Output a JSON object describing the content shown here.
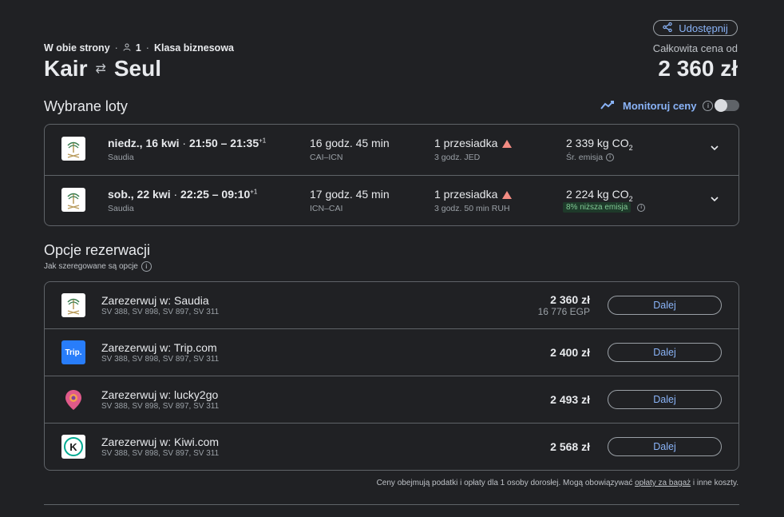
{
  "share_label": "Udostępnij",
  "trip": {
    "type": "W obie strony",
    "passengers": "1",
    "cabin": "Klasa biznesowa",
    "origin": "Kair",
    "destination": "Seul"
  },
  "price": {
    "label": "Całkowita cena od",
    "total": "2 360 zł"
  },
  "selected": {
    "title": "Wybrane loty",
    "monitor_label": "Monitoruj ceny",
    "flights": [
      {
        "date": "niedz., 16 kwi",
        "times": "21:50 – 21:35",
        "plus": "+1",
        "airline": "Saudia",
        "duration": "16 godz. 45 min",
        "airports": "CAI–ICN",
        "stops": "1 przesiadka",
        "layover": "3 godz. JED",
        "co2": "2 339 kg CO",
        "co2_sub": "2",
        "emission": "Śr. emisja"
      },
      {
        "date": "sob., 22 kwi",
        "times": "22:25 – 09:10",
        "plus": "+1",
        "airline": "Saudia",
        "duration": "17 godz. 45 min",
        "airports": "ICN–CAI",
        "stops": "1 przesiadka",
        "layover": "3 godz. 50 min RUH",
        "co2": "2 224 kg CO",
        "co2_sub": "2",
        "emission": "8% niższa emisja"
      }
    ]
  },
  "booking": {
    "title": "Opcje rezerwacji",
    "subtitle": "Jak szeregowane są opcje",
    "options": [
      {
        "title": "Zarezerwuj w: Saudia",
        "flights": "SV 388, SV 898, SV 897, SV 311",
        "price": "2 360 zł",
        "price_alt": "16 776 EGP",
        "button": "Dalej",
        "logo_text": ""
      },
      {
        "title": "Zarezerwuj w: Trip.com",
        "flights": "SV 388, SV 898, SV 897, SV 311",
        "price": "2 400 zł",
        "price_alt": "",
        "button": "Dalej",
        "logo_text": "Trip."
      },
      {
        "title": "Zarezerwuj w: lucky2go",
        "flights": "SV 388, SV 898, SV 897, SV 311",
        "price": "2 493 zł",
        "price_alt": "",
        "button": "Dalej",
        "logo_text": ""
      },
      {
        "title": "Zarezerwuj w: Kiwi.com",
        "flights": "SV 388, SV 898, SV 897, SV 311",
        "price": "2 568 zł",
        "price_alt": "",
        "button": "Dalej",
        "logo_text": "K"
      }
    ]
  },
  "footer": {
    "text_before": "Ceny obejmują podatki i opłaty dla 1 osoby dorosłej. Mogą obowiązywać ",
    "link": "opłaty za bagaż",
    "text_after": " i inne koszty."
  },
  "colors": {
    "background": "#202124",
    "accent": "#8ab4f8",
    "warning": "#f28b82",
    "eco_badge_bg": "#1e3a2a",
    "eco_badge_text": "#81c995",
    "trip_blue": "#287dfa"
  }
}
